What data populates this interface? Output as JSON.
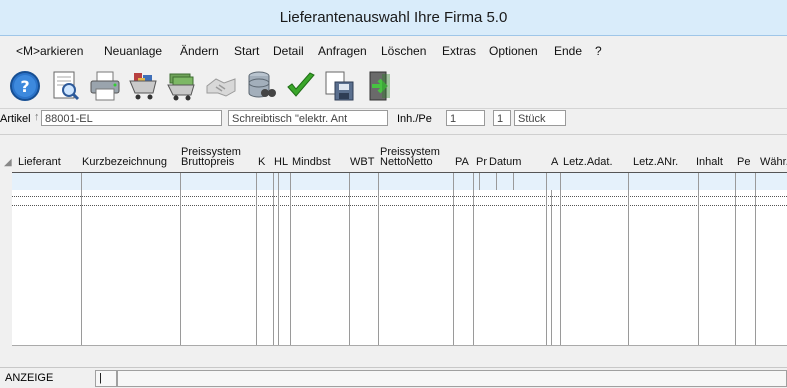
{
  "window": {
    "title": "Lieferantenauswahl Ihre Firma 5.0"
  },
  "menu": [
    "<M>arkieren",
    "Neuanlage",
    "Ändern",
    "Start",
    "Detail",
    "Anfragen",
    "Löschen",
    "Extras",
    "Optionen",
    "Ende",
    "?"
  ],
  "toolbar": [
    "help-icon",
    "print-preview-icon",
    "printer-icon",
    "shopping-cart-icon",
    "money-cart-icon",
    "handshake-icon",
    "database-search-icon",
    "checkmark-icon",
    "save-document-icon",
    "exit-door-icon"
  ],
  "artikel": {
    "label": "Artikel",
    "number": "88001-EL",
    "description": "Schreibtisch \"elektr. Ant",
    "inh_label": "Inh./Pe",
    "inh_value": "1",
    "pe_value": "1",
    "unit": "Stück"
  },
  "columns": {
    "lieferant": "Lieferant",
    "kurzbez": "Kurzbezeichnung",
    "preis1_top": "Preissystem",
    "preis1_bot": "Bruttopreis",
    "k": "K",
    "hl": "HL",
    "mindbst": "Mindbst",
    "wbt": "WBT",
    "preis2_top": "Preissystem",
    "preis2_bot": "NettoNetto",
    "pa": "PA",
    "pr": "Pr",
    "datum": "Datum",
    "a": "A",
    "letzadat": "Letz.Adat.",
    "letzanr": "Letz.ANr.",
    "inhalt": "Inhalt",
    "pe": "Pe",
    "waehr": "Währ."
  },
  "status": {
    "mode": "ANZEIGE",
    "field": "|"
  }
}
